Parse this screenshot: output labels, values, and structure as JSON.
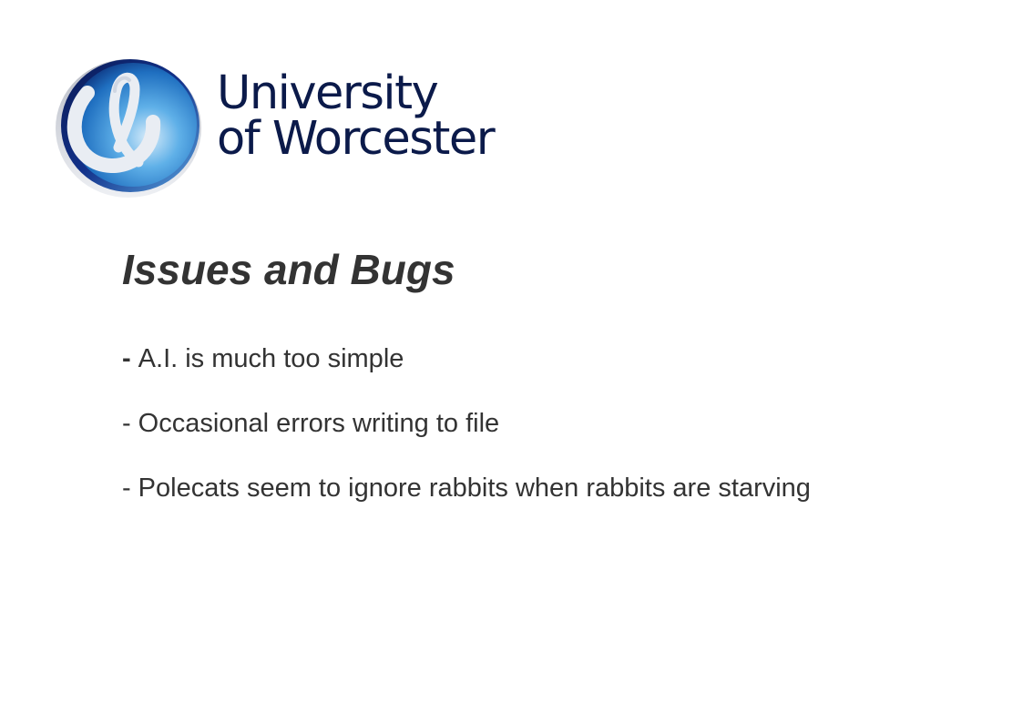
{
  "logo": {
    "line1": "University",
    "line2": "of Worcester",
    "text_color": "#0b1a4a"
  },
  "slide": {
    "title": "Issues and Bugs",
    "bullets": [
      {
        "dash": "-",
        "text": "A.I. is much too simple"
      },
      {
        "dash": "-",
        "text": "Occasional errors writing to file"
      },
      {
        "dash": "-",
        "text": "Polecats seem to ignore rabbits when rabbits are starving"
      }
    ]
  }
}
